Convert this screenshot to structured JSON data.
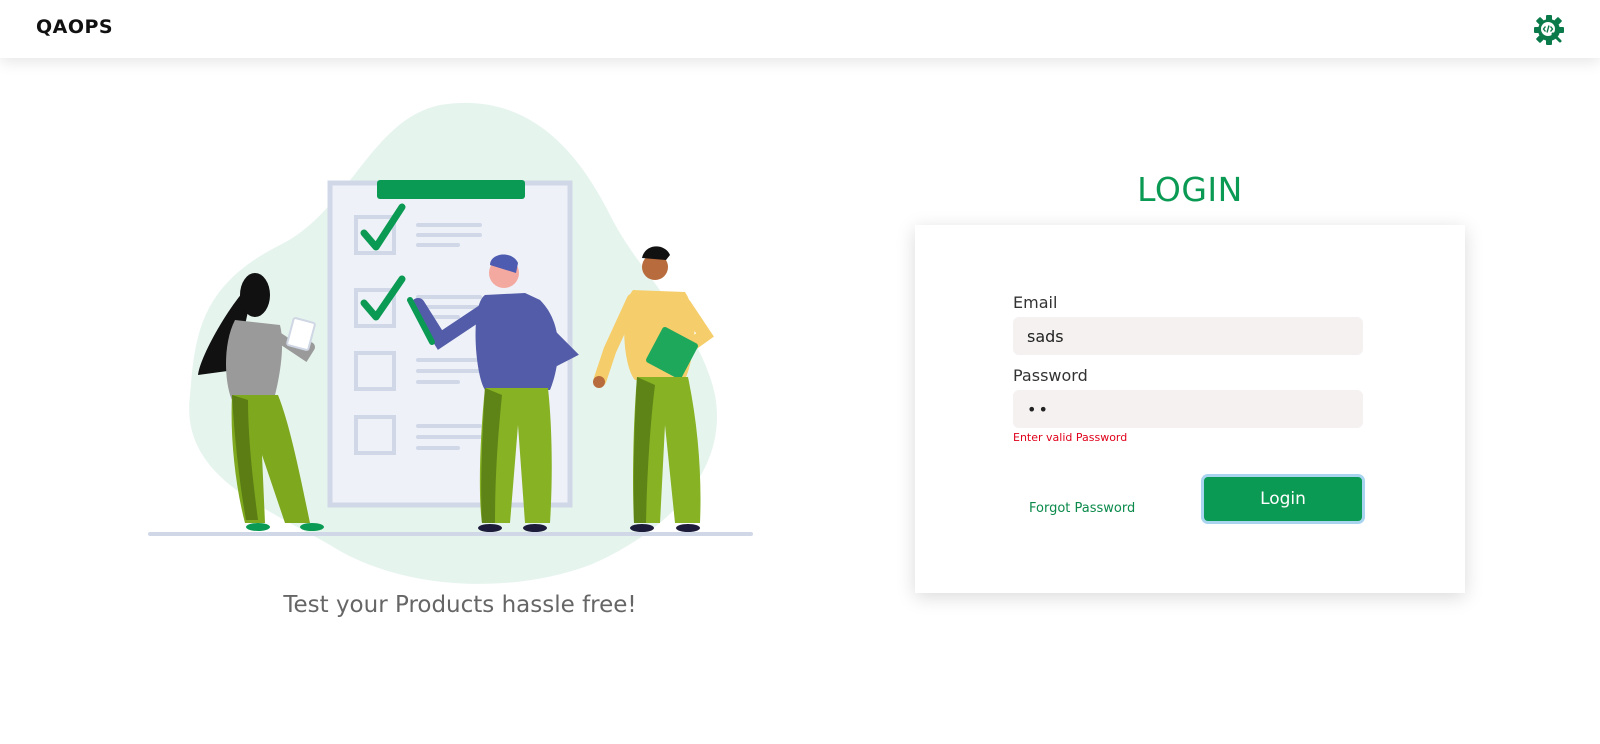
{
  "header": {
    "brand": "QAOPS",
    "settings_icon": "gear-code-search-icon"
  },
  "hero": {
    "illustration": "team-checklist-illustration",
    "tagline": "Test your Products hassle free!"
  },
  "login": {
    "title": "LOGIN",
    "email_label": "Email",
    "email_value": "sads",
    "password_label": "Password",
    "password_value": "••",
    "error": "Enter valid Password",
    "forgot_label": "Forgot Password",
    "submit_label": "Login"
  },
  "colors": {
    "accent": "#0b9a53",
    "error": "#e0001a",
    "input_bg": "#f4f1f0"
  }
}
